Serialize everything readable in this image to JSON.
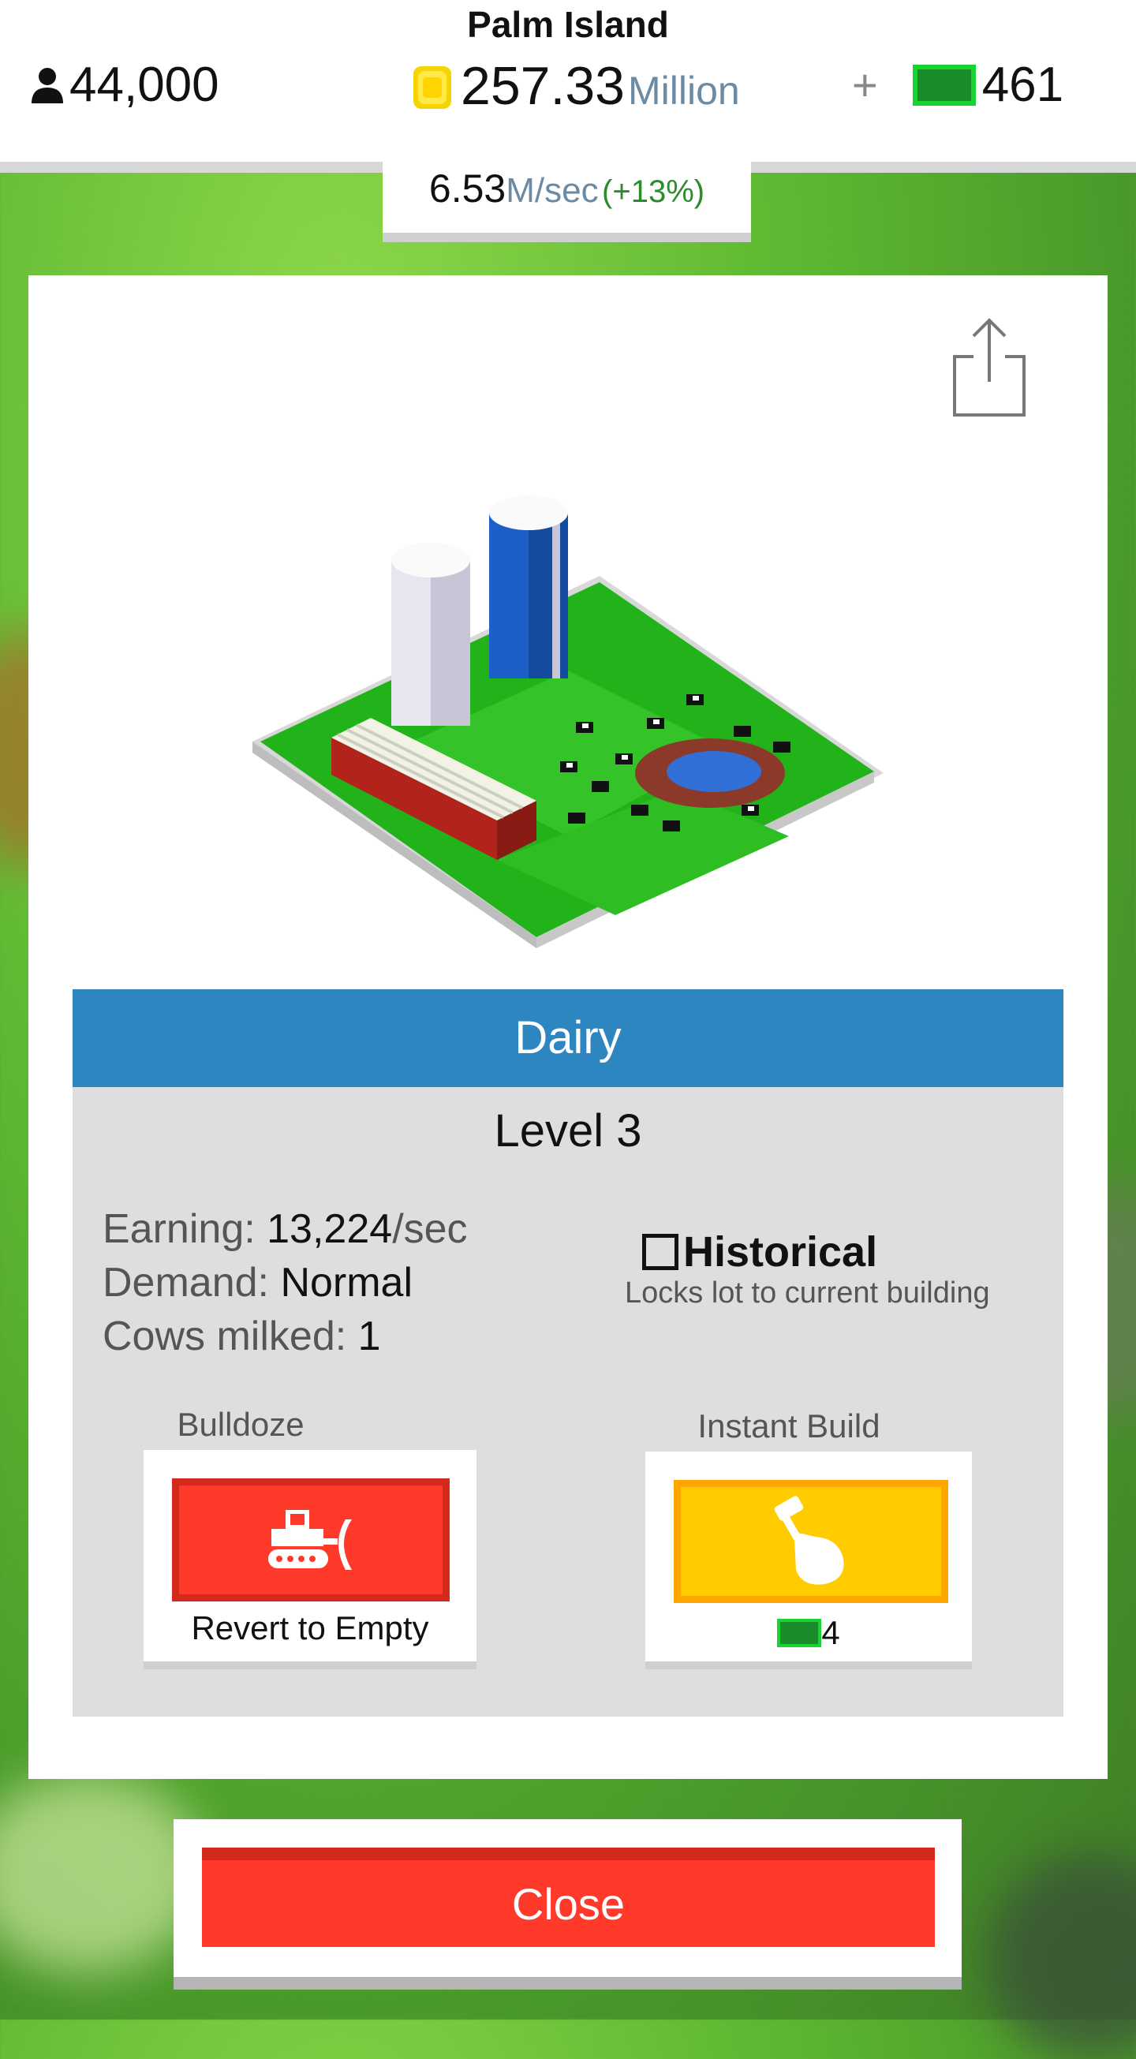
{
  "header": {
    "island_name": "Palm Island",
    "population": "44,000",
    "coins_amount": "257.33",
    "coins_unit": "Million",
    "plus": "+",
    "cash": "461",
    "rate_value": "6.53",
    "rate_unit": "M/sec",
    "rate_percent": "(+13%)"
  },
  "building": {
    "name": "Dairy",
    "level": "Level 3",
    "earning_label": "Earning:",
    "earning_value": "13,224",
    "earning_unit": "/sec",
    "demand_label": "Demand:",
    "demand_value": "Normal",
    "cows_label": "Cows milked:",
    "cows_value": "1",
    "historical_label": "Historical",
    "historical_sub": "Locks lot to current building"
  },
  "actions": {
    "bulldoze_label": "Bulldoze",
    "bulldoze_button_text": "Revert to Empty",
    "instant_label": "Instant Build",
    "instant_cost": "4"
  },
  "footer": {
    "close_label": "Close"
  },
  "colors": {
    "title_bar": "#2e86c1",
    "bulldoze_red": "#ff3a2a",
    "instant_yellow": "#ffcc00",
    "cash_green": "#2db43c"
  },
  "icons": [
    "person-icon",
    "coin-icon",
    "cash-icon",
    "share-icon",
    "bulldozer-icon",
    "hammer-hand-icon"
  ]
}
